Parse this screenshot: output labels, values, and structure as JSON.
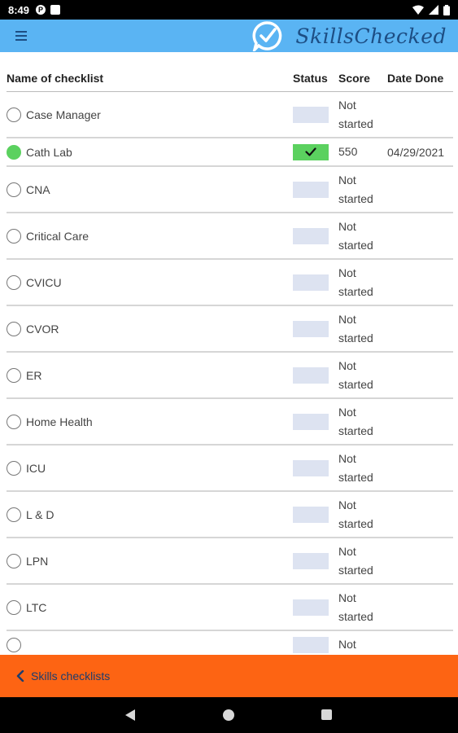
{
  "status_bar": {
    "time": "8:49"
  },
  "app": {
    "name": "SkillsChecked",
    "accent": "#5ab4f3",
    "bottom_color": "#fd6413",
    "done_color": "#5bd15f"
  },
  "table": {
    "headers": {
      "name": "Name of checklist",
      "status": "Status",
      "score": "Score",
      "date": "Date Done"
    },
    "rows": [
      {
        "name": "Case Manager",
        "done": false,
        "score_line1": "Not",
        "score_line2": "started",
        "date": ""
      },
      {
        "name": "Cath Lab",
        "done": true,
        "score_line1": "550",
        "score_line2": "",
        "date": "04/29/2021"
      },
      {
        "name": "CNA",
        "done": false,
        "score_line1": "Not",
        "score_line2": "started",
        "date": ""
      },
      {
        "name": "Critical Care",
        "done": false,
        "score_line1": "Not",
        "score_line2": "started",
        "date": ""
      },
      {
        "name": "CVICU",
        "done": false,
        "score_line1": "Not",
        "score_line2": "started",
        "date": ""
      },
      {
        "name": "CVOR",
        "done": false,
        "score_line1": "Not",
        "score_line2": "started",
        "date": ""
      },
      {
        "name": "ER",
        "done": false,
        "score_line1": "Not",
        "score_line2": "started",
        "date": ""
      },
      {
        "name": "Home Health",
        "done": false,
        "score_line1": "Not",
        "score_line2": "started",
        "date": ""
      },
      {
        "name": "ICU",
        "done": false,
        "score_line1": "Not",
        "score_line2": "started",
        "date": ""
      },
      {
        "name": "L & D",
        "done": false,
        "score_line1": "Not",
        "score_line2": "started",
        "date": ""
      },
      {
        "name": "LPN",
        "done": false,
        "score_line1": "Not",
        "score_line2": "started",
        "date": ""
      },
      {
        "name": "LTC",
        "done": false,
        "score_line1": "Not",
        "score_line2": "started",
        "date": ""
      },
      {
        "name": "",
        "done": false,
        "score_line1": "Not",
        "score_line2": "",
        "date": ""
      }
    ]
  },
  "bottom_bar": {
    "label": "Skills checklists"
  }
}
